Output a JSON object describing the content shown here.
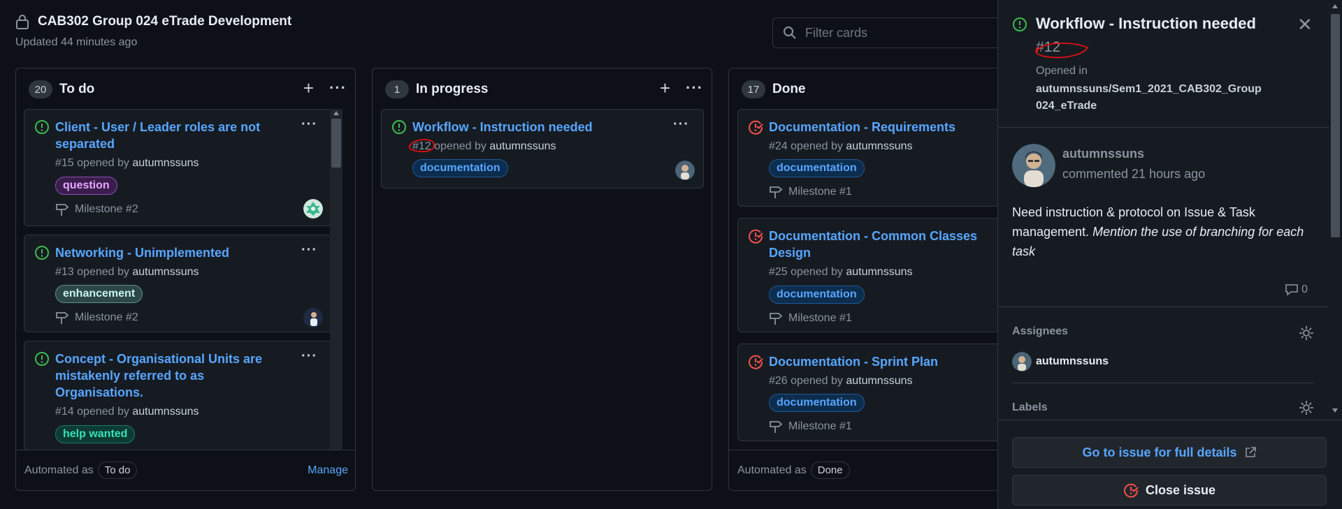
{
  "project": {
    "title": "CAB302 Group 024 eTrade Development",
    "updated": "Updated 44 minutes ago",
    "filter_placeholder": "Filter cards"
  },
  "columns": [
    {
      "name": "To do",
      "count": "20",
      "automated_label": "Automated as",
      "automated_value": "To do",
      "manage": "Manage",
      "cards": [
        {
          "title": "Client - User / Leader roles are not separated",
          "meta_prefix": "#15 opened by",
          "user": "autumnssuns",
          "label": "question",
          "milestone": "Milestone #2"
        },
        {
          "title": "Networking - Unimplemented",
          "meta_prefix": "#13 opened by",
          "user": "autumnssuns",
          "label": "enhancement",
          "milestone": "Milestone #2"
        },
        {
          "title": "Concept - Organisational Units are mistakenly referred to as Organisations.",
          "meta_prefix": "#14 opened by",
          "user": "autumnssuns",
          "label": "help wanted"
        }
      ]
    },
    {
      "name": "In progress",
      "count": "1",
      "cards": [
        {
          "title": "Workflow - Instruction needed",
          "meta_prefix": "#12 opened by",
          "user": "autumnssuns",
          "label": "documentation"
        }
      ]
    },
    {
      "name": "Done",
      "count": "17",
      "automated_label": "Automated as",
      "automated_value": "Done",
      "cards": [
        {
          "title": "Documentation - Requirements",
          "meta_prefix": "#24 opened by",
          "user": "autumnssuns",
          "label": "documentation",
          "milestone": "Milestone #1"
        },
        {
          "title": "Documentation - Common Classes Design",
          "meta_prefix": "#25 opened by",
          "user": "autumnssuns",
          "label": "documentation",
          "milestone": "Milestone #1"
        },
        {
          "title": "Documentation - Sprint Plan",
          "meta_prefix": "#26 opened by",
          "user": "autumnssuns",
          "label": "documentation",
          "milestone": "Milestone #1"
        }
      ]
    }
  ],
  "panel": {
    "title": "Workflow - Instruction needed",
    "number": "#12",
    "opened_in": "Opened in",
    "repo": "autumnssuns/Sem1_2021_CAB302_Group024_eTrade",
    "author": "autumnssuns",
    "commented": "commented 21 hours ago",
    "body_plain": "Need instruction & protocol on Issue & Task management.",
    "body_italic": "Mention the use of branching for each task",
    "comment_count": "0",
    "assignees_title": "Assignees",
    "assignee": "autumnssuns",
    "labels_title": "Labels",
    "go_button": "Go to issue for full details",
    "close_button": "Close issue"
  },
  "colors": {
    "background": "#0d1117",
    "card": "#161b22",
    "link": "#58a6ff",
    "open_green": "#3fb950",
    "closed_red": "#f85149",
    "annotation_red": "#e01010"
  },
  "icons": [
    "lock-icon",
    "search-icon",
    "issue-open-icon",
    "issue-closed-icon",
    "milestone-icon",
    "kebab-icon",
    "plus-icon",
    "close-icon",
    "comment-icon",
    "gear-icon",
    "external-link-icon"
  ]
}
